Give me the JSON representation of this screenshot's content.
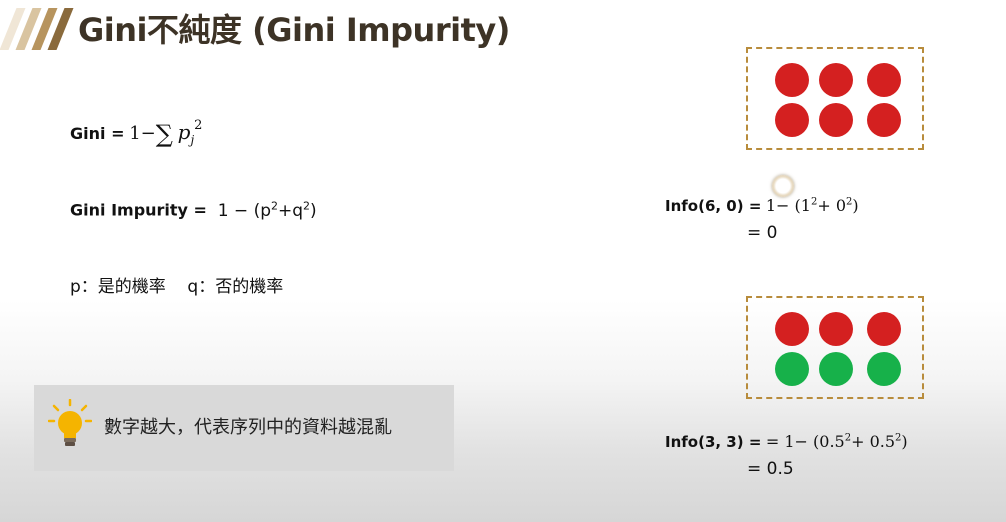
{
  "title": "Gini不純度 (Gini Impurity)",
  "colors": {
    "title": "#3d3326",
    "stripes": [
      "#f0e6d6",
      "#d9c4a0",
      "#b7945e",
      "#8a6a3c"
    ],
    "red_dot": "#d42020",
    "green_dot": "#17b14a",
    "dashed_border": "#b88c3c",
    "tip_bg": "#d9d9d9",
    "bulb": "#f5b400"
  },
  "formulas": {
    "gini_label": "Gini =",
    "gini_one": "1",
    "gini_minus": "−",
    "gini_sum": "∑",
    "gini_p": "p",
    "gini_sub": "j",
    "gini_sup": "2",
    "impurity_label": "Gini Impurity =",
    "impurity_prefix": "1 − (p",
    "impurity_sup1": "2",
    "impurity_mid": "+q",
    "impurity_sup2": "2",
    "impurity_suffix": ")",
    "definitions": "p：是的機率    q：否的機率"
  },
  "tip": {
    "icon": "lightbulb-icon",
    "text": "數字越大，代表序列中的資料越混亂"
  },
  "examples": [
    {
      "dots": [
        "red",
        "red",
        "red",
        "red",
        "red",
        "red"
      ],
      "label": "Info(6, 0) =",
      "formula_a": "1−",
      "formula_b": " (1",
      "sup1": "2",
      "formula_c": "+ 0",
      "sup2": "2",
      "formula_d": ")",
      "result": "= 0"
    },
    {
      "dots": [
        "red",
        "red",
        "red",
        "green",
        "green",
        "green"
      ],
      "label": "Info(3, 3) =",
      "formula_a": "= 1− ",
      "formula_b": "(0.5",
      "sup1": "2",
      "formula_c": "+ 0.5",
      "sup2": "2",
      "formula_d": ")",
      "result": "= 0.5"
    }
  ]
}
